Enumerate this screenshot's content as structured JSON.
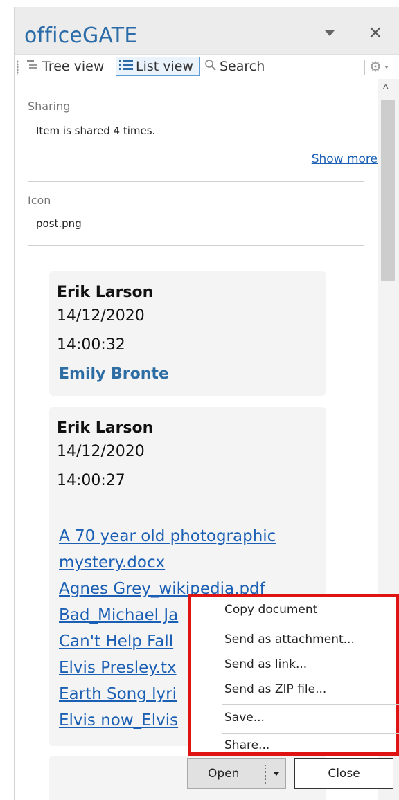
{
  "app": {
    "title": "officeGATE"
  },
  "toolbar": {
    "tree_view": "Tree view",
    "list_view": "List view",
    "search": "Search"
  },
  "properties": [
    {
      "label": "Sharing",
      "value": "Item is shared 4 times.",
      "link": "Show more"
    },
    {
      "label": "Icon",
      "value": "post.png"
    }
  ],
  "comments": [
    {
      "author": "Erik Larson",
      "date": "14/12/2020",
      "time": "14:00:32",
      "mention": "Emily Bronte"
    },
    {
      "author": "Erik Larson",
      "date": "14/12/2020",
      "time": "14:00:27",
      "files": [
        "A 70 year old photographic",
        "mystery.docx",
        "Agnes Grey_wikipedia.pdf",
        "Bad_Michael Ja",
        "Can't Help Fall",
        "Elvis Presley.tx",
        "Earth Song lyri",
        "Elvis now_Elvis"
      ]
    }
  ],
  "context_menu": {
    "items": [
      "Copy document",
      "Send as attachment...",
      "Send as link...",
      "Send as ZIP file...",
      "Save...",
      "Share..."
    ]
  },
  "buttons": {
    "open": "Open",
    "close": "Close"
  },
  "colors": {
    "accent": "#2b6ca8",
    "link": "#1a5fb4",
    "highlight_border": "#e01313"
  },
  "icons": [
    "tree-view-icon",
    "list-view-icon",
    "search-icon",
    "gear-icon",
    "close-icon",
    "chevron-down-icon",
    "scroll-up-icon"
  ]
}
